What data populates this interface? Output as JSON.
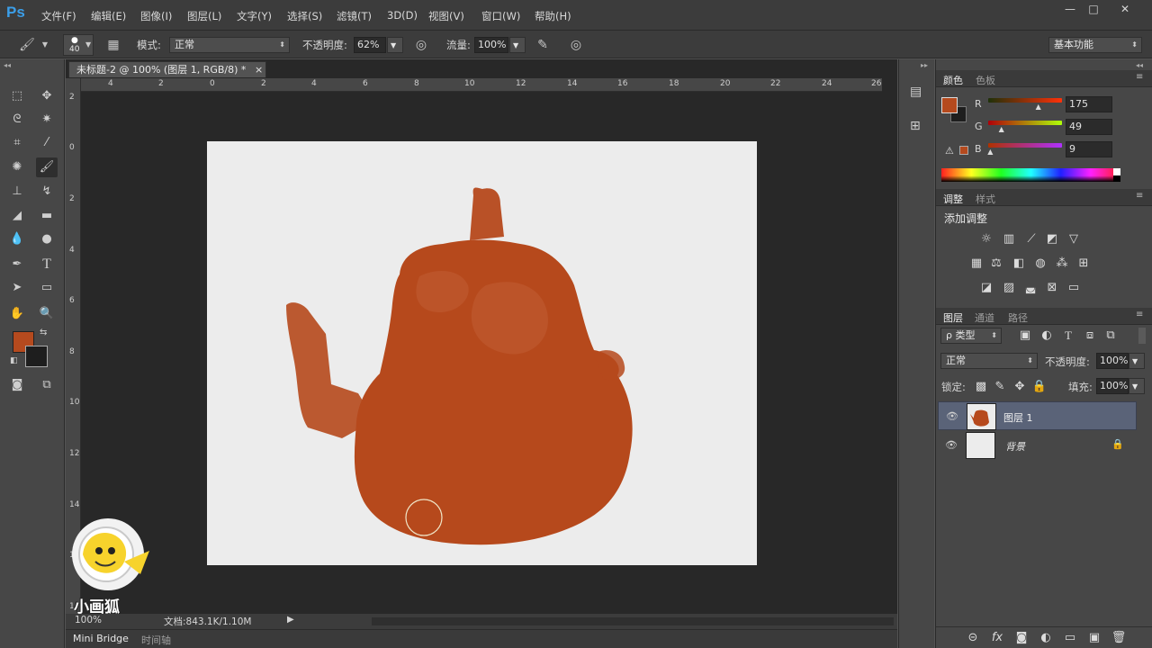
{
  "app": {
    "logo": "Ps"
  },
  "menu": [
    "文件(F)",
    "编辑(E)",
    "图像(I)",
    "图层(L)",
    "文字(Y)",
    "选择(S)",
    "滤镜(T)",
    "3D(D)",
    "视图(V)",
    "窗口(W)",
    "帮助(H)"
  ],
  "window_controls": {
    "minimize": "—",
    "maximize": "□",
    "close": "✕"
  },
  "options": {
    "brush_size": "40",
    "mode_label": "模式:",
    "mode_value": "正常",
    "opacity_label": "不透明度:",
    "opacity_value": "62%",
    "flow_label": "流量:",
    "flow_value": "100%",
    "workspace": "基本功能"
  },
  "document": {
    "tab_title": "未标题-2 @ 100% (图层 1, RGB/8) *",
    "ruler_h": [
      "4",
      "2",
      "0",
      "2",
      "4",
      "6",
      "8",
      "10",
      "12",
      "14",
      "16",
      "18",
      "20",
      "22",
      "24",
      "26"
    ],
    "ruler_v": [
      "2",
      "0",
      "2",
      "4",
      "6",
      "8",
      "10",
      "12",
      "14",
      "16",
      "1"
    ],
    "zoom": "100%",
    "doc_info": "文档:843.1K/1.10M",
    "watermark": "小画狐"
  },
  "bottom_tabs": [
    "Mini Bridge",
    "时间轴"
  ],
  "colors": {
    "foreground": "#b54a1e",
    "background": "#1e1e1e",
    "paint": "#b6491c",
    "tabs": [
      "颜色",
      "色板"
    ],
    "R_label": "R",
    "G_label": "G",
    "B_label": "B",
    "R": "175",
    "G": "49",
    "B": "9",
    "R_level": 0.69,
    "G_level": 0.19,
    "B_level": 0.04
  },
  "adjustments": {
    "tabs": [
      "调整",
      "样式"
    ],
    "title": "添加调整"
  },
  "layers": {
    "tabs": [
      "图层",
      "通道",
      "路径"
    ],
    "filter_label": "ρ 类型",
    "blend_mode": "正常",
    "opacity_label": "不透明度:",
    "opacity_value": "100%",
    "lock_label": "锁定:",
    "fill_label": "填充:",
    "fill_value": "100%",
    "items": [
      {
        "name": "图层 1",
        "selected": true
      },
      {
        "name": "背景",
        "selected": false,
        "locked": true
      }
    ],
    "footer_icons": [
      "link-icon",
      "fx-icon",
      "mask-icon",
      "adjustment-icon",
      "group-icon",
      "new-layer-icon",
      "trash-icon"
    ],
    "footer_labels": [
      "⊝",
      "fx",
      "◙",
      "◐",
      "▭",
      "▣",
      "🗑"
    ]
  }
}
